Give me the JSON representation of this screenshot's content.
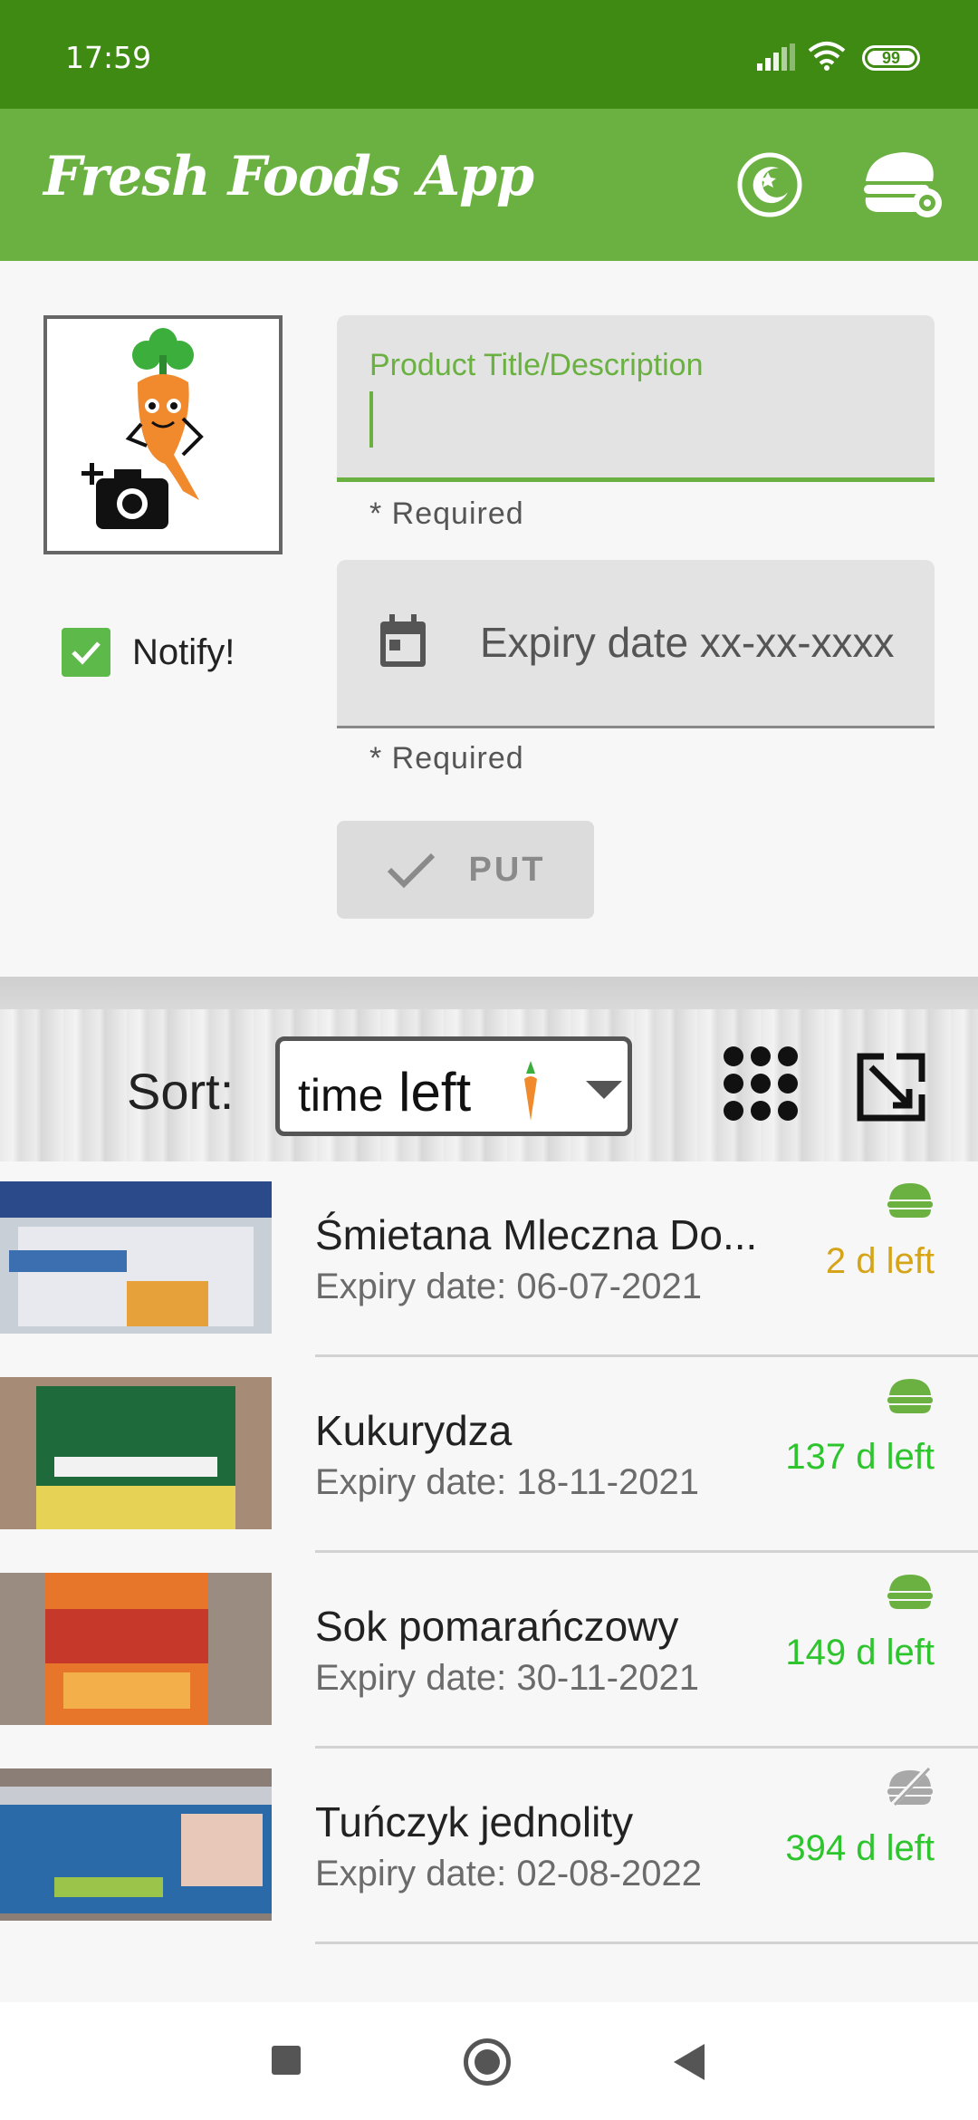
{
  "status_bar": {
    "time": "17:59",
    "battery": "99"
  },
  "app": {
    "title": "Fresh Foods App",
    "icons": {
      "theme": "moon-star-icon",
      "settings": "food-settings-icon"
    },
    "colors": {
      "primary": "#6ab142",
      "primary_dark": "#3e8a12",
      "accent_green": "#2ec42e",
      "warning": "#d6a419"
    }
  },
  "form": {
    "photo_icon": "add-photo-icon",
    "notify": {
      "label": "Notify!",
      "checked": true
    },
    "title_field": {
      "label": "Product Title/Description",
      "value": "",
      "helper": "* Required"
    },
    "date_field": {
      "placeholder": "Expiry date xx-xx-xxxx",
      "helper": "* Required",
      "icon": "calendar-icon"
    },
    "submit": {
      "label": "PUT",
      "icon": "check-icon"
    }
  },
  "sort": {
    "label": "Sort:",
    "selected_time": "time",
    "selected_left": "left",
    "options_visible": [
      "time left"
    ],
    "grid_icon": "grid-view-icon",
    "expand_icon": "expand-icon"
  },
  "products": [
    {
      "title": "Śmietana Mleczna Do...",
      "expiry": "Expiry date: 06-07-2021",
      "left": "2 d left",
      "status": "warning",
      "notify_icon": "notify-on-icon"
    },
    {
      "title": "Kukurydza",
      "expiry": "Expiry date: 18-11-2021",
      "left": "137 d left",
      "status": "fresh",
      "notify_icon": "notify-on-icon"
    },
    {
      "title": "Sok pomarańczowy",
      "expiry": "Expiry date: 30-11-2021",
      "left": "149 d left",
      "status": "fresh",
      "notify_icon": "notify-on-icon"
    },
    {
      "title": "Tuńczyk jednolity",
      "expiry": "Expiry date: 02-08-2022",
      "left": "394 d left",
      "status": "fresh",
      "notify_icon": "notify-off-icon"
    }
  ]
}
